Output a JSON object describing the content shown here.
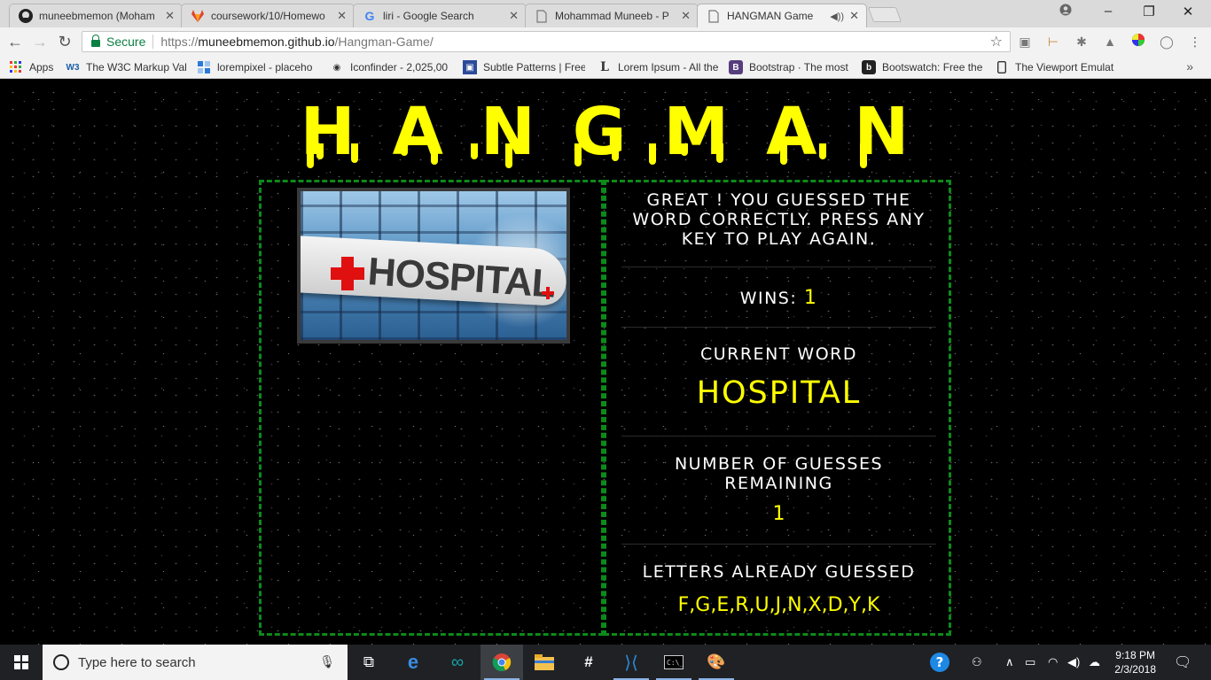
{
  "browser": {
    "tabs": [
      {
        "title": "muneebmemon (Moham",
        "favicon": "github-icon"
      },
      {
        "title": "coursework/10/Homewo",
        "favicon": "gitlab-icon"
      },
      {
        "title": "liri - Google Search",
        "favicon": "google-icon"
      },
      {
        "title": "Mohammad Muneeb - P",
        "favicon": "page-icon"
      },
      {
        "title": "HANGMAN Game",
        "favicon": "page-icon",
        "active": true,
        "audio": true
      }
    ],
    "address": {
      "secure_label": "Secure",
      "url_scheme": "https://",
      "url_host": "muneebmemon.github.io",
      "url_path": "/Hangman-Game/"
    },
    "bookmarks": [
      {
        "label": "Apps",
        "icon": "apps-grid-icon"
      },
      {
        "label": "The W3C Markup Val",
        "icon": "w3c-icon"
      },
      {
        "label": "lorempixel - placeho",
        "icon": "lorempixel-icon"
      },
      {
        "label": "Iconfinder - 2,025,00",
        "icon": "iconfinder-icon"
      },
      {
        "label": "Subtle Patterns | Free",
        "icon": "subtle-patterns-icon"
      },
      {
        "label": "Lorem Ipsum - All the",
        "icon": "lorem-ipsum-icon"
      },
      {
        "label": "Bootstrap · The most",
        "icon": "bootstrap-icon"
      },
      {
        "label": "Bootswatch: Free the",
        "icon": "bootswatch-icon"
      },
      {
        "label": "The Viewport Emulat",
        "icon": "viewport-icon"
      }
    ]
  },
  "page": {
    "title": "HANGMAN",
    "message": "GREAT ! YOU GUESSED THE WORD CORRECTLY. PRESS ANY KEY TO PLAY AGAIN.",
    "wins_label": "WINS:",
    "wins_value": "1",
    "current_word_label": "CURRENT WORD",
    "current_word": "HOSPITAL",
    "guesses_label": "NUMBER OF GUESSES REMAINING",
    "guesses_value": "1",
    "letters_label": "LETTERS ALREADY GUESSED",
    "letters_value": "F,G,E,R,U,J,N,X,D,Y,K",
    "image_sign_text": "HOSPITAL",
    "colors": {
      "accent": "#ffff00",
      "border": "#0d8a1a",
      "background": "#000000"
    }
  },
  "taskbar": {
    "search_placeholder": "Type here to search",
    "time": "9:18 PM",
    "date": "2/3/2018"
  }
}
